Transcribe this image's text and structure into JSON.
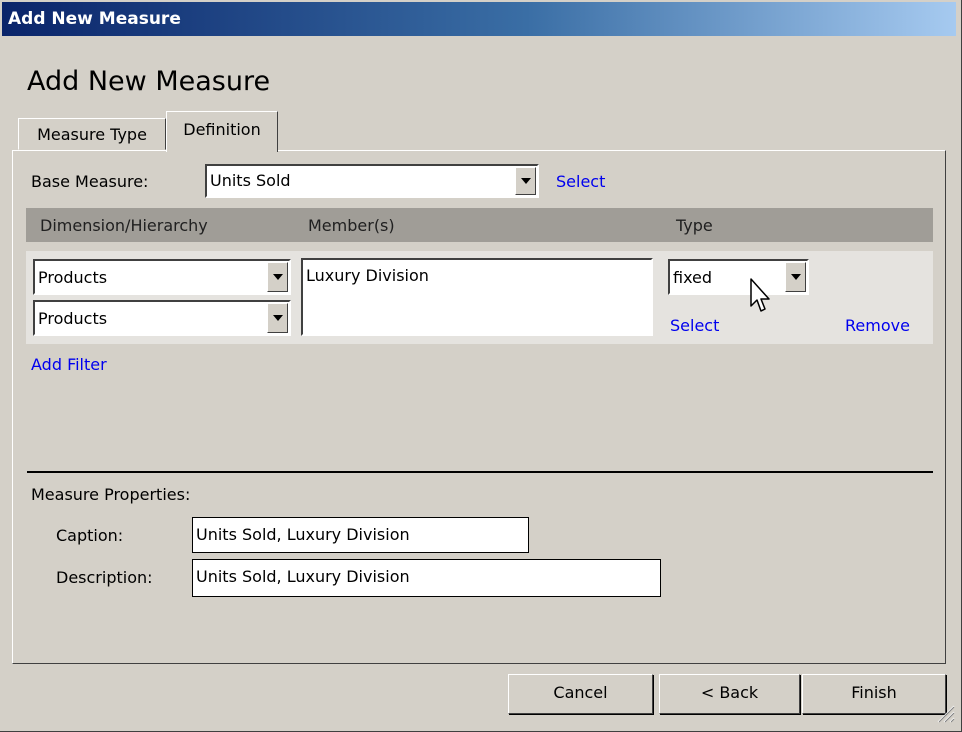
{
  "window": {
    "title": "Add New Measure"
  },
  "page": {
    "heading": "Add New Measure"
  },
  "tabs": [
    {
      "label": "Measure Type",
      "active": false
    },
    {
      "label": "Definition",
      "active": true
    }
  ],
  "base_measure": {
    "label": "Base Measure:",
    "value": "Units Sold",
    "select_link": "Select"
  },
  "filter_table": {
    "columns": [
      "Dimension/Hierarchy",
      "Member(s)",
      "Type"
    ],
    "rows": [
      {
        "dimension": "Products",
        "hierarchy": "Products",
        "members": "Luxury Division",
        "type": "fixed",
        "select_link": "Select",
        "remove_link": "Remove"
      }
    ],
    "add_filter_link": "Add Filter"
  },
  "measure_properties": {
    "label": "Measure Properties:",
    "caption_label": "Caption:",
    "caption_value": "Units Sold, Luxury Division",
    "description_label": "Description:",
    "description_value": "Units Sold, Luxury Division"
  },
  "buttons": {
    "cancel": "Cancel",
    "back": "< Back",
    "finish": "Finish"
  },
  "colors": {
    "link": "#0000ee",
    "dialog_bg": "#d4d0c8",
    "titlebar_start": "#0a246a"
  }
}
